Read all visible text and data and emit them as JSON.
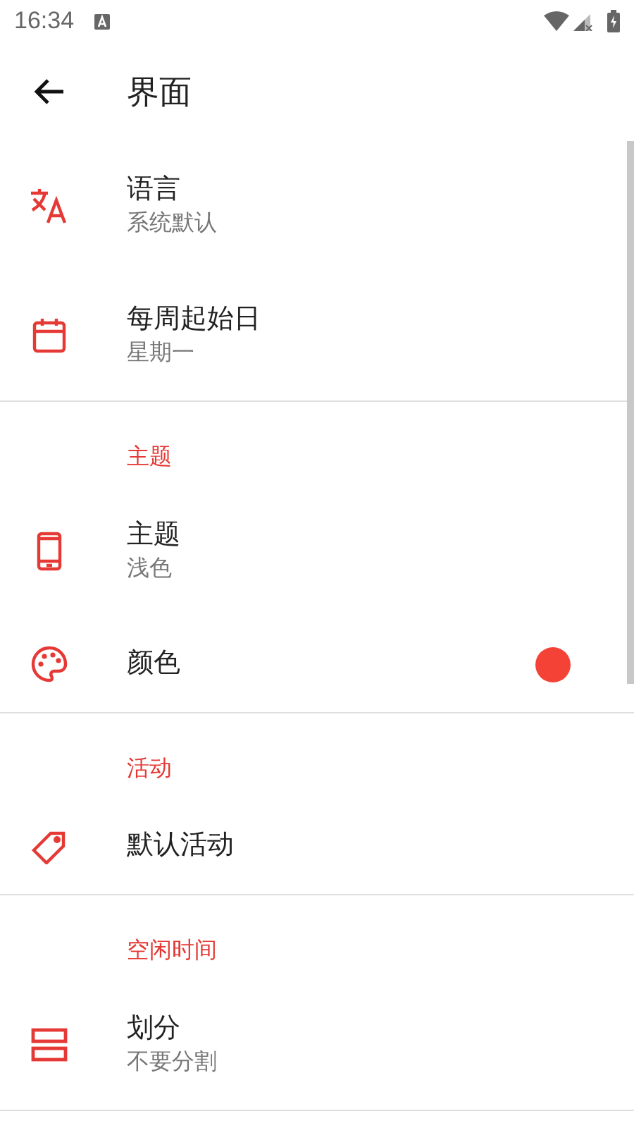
{
  "status_bar": {
    "time": "16:34"
  },
  "app_bar": {
    "title": "界面"
  },
  "sections": [
    {
      "items": [
        {
          "title": "语言",
          "subtitle": "系统默认"
        },
        {
          "title": "每周起始日",
          "subtitle": "星期一"
        }
      ]
    },
    {
      "header": "主题",
      "items": [
        {
          "title": "主题",
          "subtitle": "浅色"
        },
        {
          "title": "颜色",
          "color": "#f44336"
        }
      ]
    },
    {
      "header": "活动",
      "items": [
        {
          "title": "默认活动"
        }
      ]
    },
    {
      "header": "空闲时间",
      "items": [
        {
          "title": "划分",
          "subtitle": "不要分割"
        }
      ]
    }
  ]
}
